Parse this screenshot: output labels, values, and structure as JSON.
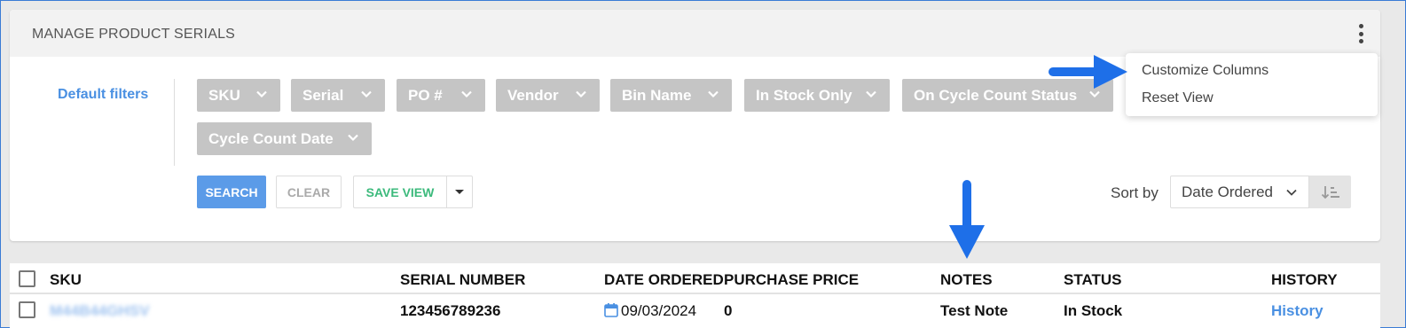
{
  "header": {
    "title": "MANAGE PRODUCT SERIALS"
  },
  "filters": {
    "label": "Default filters",
    "chips": [
      "SKU",
      "Serial",
      "PO #",
      "Vendor",
      "Bin Name",
      "In Stock Only",
      "On Cycle Count Status",
      "Cycle Count Date"
    ]
  },
  "actions": {
    "search": "SEARCH",
    "clear": "CLEAR",
    "save_view": "SAVE VIEW"
  },
  "sort": {
    "label": "Sort by",
    "selected": "Date Ordered"
  },
  "menu": {
    "items": [
      "Customize Columns",
      "Reset View"
    ]
  },
  "table": {
    "columns": [
      "SKU",
      "SERIAL NUMBER",
      "DATE ORDERED",
      "PURCHASE PRICE",
      "NOTES",
      "STATUS",
      "HISTORY"
    ],
    "rows": [
      {
        "sku": "M44B44GHSV",
        "serial": "123456789236",
        "date_ordered": "09/03/2024",
        "purchase_price": "0",
        "notes": "Test Note",
        "status": "In Stock",
        "history": "History"
      }
    ]
  },
  "colors": {
    "accent": "#4a90e2",
    "annotation_arrow": "#1e6fe8",
    "chip_bg": "#c5c5c5",
    "save_green": "#3cba7c"
  }
}
